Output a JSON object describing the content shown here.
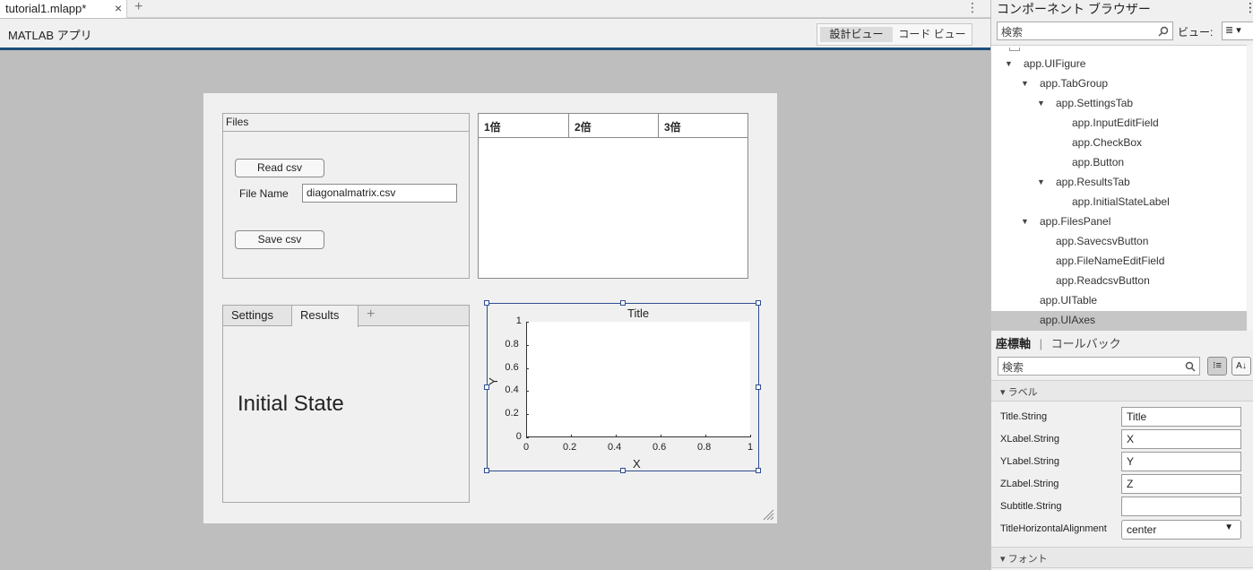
{
  "document_tab": {
    "label": "tutorial1.mlapp*",
    "close_glyph": "×",
    "add_glyph": "+"
  },
  "app_title": "MATLAB アプリ",
  "view_toggle": {
    "design": "設計ビュー",
    "code": "コード ビュー"
  },
  "files_panel": {
    "title": "Files",
    "read_button": "Read csv",
    "filename_label": "File Name",
    "filename_value": "diagonalmatrix.csv",
    "save_button": "Save csv"
  },
  "table": {
    "columns": [
      "1倍",
      "2倍",
      "3倍"
    ]
  },
  "tab_group": {
    "tabs": [
      "Settings",
      "Results"
    ],
    "active": "Results",
    "add_glyph": "+",
    "content_label": "Initial State"
  },
  "chart_data": {
    "type": "line",
    "title": "Title",
    "xlabel": "X",
    "ylabel": "Y",
    "xlim": [
      0,
      1
    ],
    "ylim": [
      0,
      1
    ],
    "xticks": [
      "0",
      "0.2",
      "0.4",
      "0.6",
      "0.8",
      "1"
    ],
    "yticks": [
      "0",
      "0.2",
      "0.4",
      "0.6",
      "0.8",
      "1"
    ],
    "series": []
  },
  "component_browser": {
    "title": "コンポーネント ブラウザー",
    "search_placeholder": "検索",
    "view_label": "ビュー:",
    "tree": [
      {
        "label": "app.UIFigure",
        "level": 0,
        "expanded": true
      },
      {
        "label": "app.TabGroup",
        "level": 1,
        "expanded": true
      },
      {
        "label": "app.SettingsTab",
        "level": 2,
        "expanded": true
      },
      {
        "label": "app.InputEditField",
        "level": 3
      },
      {
        "label": "app.CheckBox",
        "level": 3
      },
      {
        "label": "app.Button",
        "level": 3
      },
      {
        "label": "app.ResultsTab",
        "level": 2,
        "expanded": true
      },
      {
        "label": "app.InitialStateLabel",
        "level": 3
      },
      {
        "label": "app.FilesPanel",
        "level": 1,
        "expanded": true
      },
      {
        "label": "app.SavecsvButton",
        "level": 2
      },
      {
        "label": "app.FileNameEditField",
        "level": 2
      },
      {
        "label": "app.ReadcsvButton",
        "level": 2
      },
      {
        "label": "app.UITable",
        "level": 1
      },
      {
        "label": "app.UIAxes",
        "level": 1,
        "selected": true
      }
    ]
  },
  "inspector": {
    "tab_axes": "座標軸",
    "separator": "|",
    "tab_callbacks": "コールバック",
    "search_placeholder": "検索",
    "section_label": "ラベル",
    "section_font": "フォント",
    "properties": [
      {
        "name": "Title.String",
        "value": "Title"
      },
      {
        "name": "XLabel.String",
        "value": "X"
      },
      {
        "name": "YLabel.String",
        "value": "Y"
      },
      {
        "name": "ZLabel.String",
        "value": "Z"
      },
      {
        "name": "Subtitle.String",
        "value": ""
      },
      {
        "name": "TitleHorizontalAlignment",
        "value": "center"
      }
    ]
  },
  "colors": {
    "accent": "#1e4e79",
    "selection": "#2f4d8f",
    "canvas": "#bebebe"
  }
}
